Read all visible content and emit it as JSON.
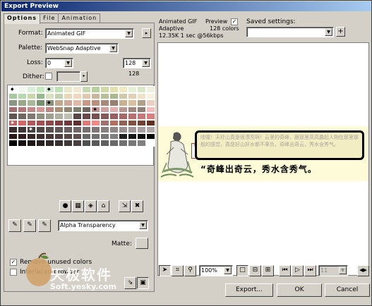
{
  "window": {
    "title": "Export Preview"
  },
  "tabs": [
    {
      "label": "Options"
    },
    {
      "label": "File"
    },
    {
      "label": "Animation"
    }
  ],
  "options": {
    "format_label": "Format:",
    "format_value": "Animated GIF",
    "palette_label": "Palette:",
    "palette_value": "WebSnap Adaptive",
    "loss_label": "Loss:",
    "loss_value": "0",
    "colors_value": "128",
    "colors_count": "128",
    "dither_label": "Dither:",
    "transparency_value": "Alpha Transparency",
    "matte_label": "Matte:",
    "remove_unused_label": "Remove unused colors",
    "interlaced_label": "Interlaced browser"
  },
  "palette_rows": [
    [
      "#ffffff",
      "#f0f8f0",
      "#d8f0d8",
      "#c8e8c0",
      "#d0e8d0",
      "#c0e0b8",
      "#e8e8c8",
      "#f0e8d0",
      "#c8d8b0",
      "#b8d0a0",
      "#d0d8a8",
      "#e0e0b0",
      "#f0e8c0",
      "#e8f0d8",
      "#d8e8c8",
      "#f0f0e0"
    ],
    [
      "#a8c8a0",
      "#b8d8b0",
      "#c8d8a8",
      "#98b890",
      "#d8e0c0",
      "#c0d0b0",
      "#e8d8b8",
      "#f0d8c0",
      "#e0c8b0",
      "#c8b8a0",
      "#b8c098",
      "#a8b890",
      "#d0c8a8",
      "#e0d0b8",
      "#f0e0c8",
      "#f8f0e0"
    ],
    [
      "#889880",
      "#98a888",
      "#a8b898",
      "#789070",
      "#889078",
      "#c0a890",
      "#d0a898",
      "#e0b8a8",
      "#c89888",
      "#b89080",
      "#a88878",
      "#988070",
      "#c8b090",
      "#d8c0a0",
      "#b0a088",
      "#e8d0c0"
    ],
    [
      "#a07070",
      "#b07878",
      "#c08888",
      "#d09898",
      "#b88880",
      "#a89078",
      "#908870",
      "#808070",
      "#706860",
      "#c09090",
      "#d0a0a0",
      "#e0b0b0",
      "#b89890",
      "#a08880",
      "#908078",
      "#f0c0c0"
    ],
    [
      "#605850",
      "#706860",
      "#807870",
      "#909080",
      "#a0a090",
      "#b0b0a0",
      "#c0c0b0",
      "#584848",
      "#684848",
      "#785050",
      "#885858",
      "#986060",
      "#a86868",
      "#b87070",
      "#c87878",
      "#d88080"
    ],
    [
      "#c06060",
      "#d06868",
      "#b05858",
      "#a05050",
      "#904848",
      "#804040",
      "#703838",
      "#603030",
      "#e07878",
      "#f08888",
      "#a07070",
      "#b07060",
      "#906050",
      "#805040",
      "#704030",
      "#603020"
    ],
    [
      "#383030",
      "#403838",
      "#484040",
      "#504848",
      "#585050",
      "#605858",
      "#686060",
      "#706868",
      "#787070",
      "#807878",
      "#888080",
      "#908888",
      "#989090",
      "#a09898",
      "#a8a0a0",
      "#b0a8a8"
    ],
    [
      "#281818",
      "#302020",
      "#382828",
      "#403030",
      "#483838",
      "#504040",
      "#584848",
      "#605050",
      "#686868",
      "#707070",
      "#787878",
      "#808080",
      "#202020",
      "#181818",
      "#101010",
      "#080808"
    ],
    [
      "#000000",
      "#181010",
      "#201818",
      "#282020",
      "#302828",
      "#383030",
      "#403838",
      "#484040",
      "#505050",
      "#585858",
      "#606060",
      "#686868",
      "#707070",
      "#787878",
      "#808080",
      "#ffffff"
    ]
  ],
  "preview": {
    "format": "Animated GIF",
    "palette": "Adaptive",
    "stats": "12.35K  1 sec @56kbps",
    "preview_label": "Preview",
    "colors_text": "128 colors",
    "saved_label": "Saved settings:",
    "caption": "“奇峰出奇云，秀水含秀气。",
    "bubble_text": "哇噻！天柱山真是很漂亮啊！云里的奇峰，跟那里高高矗起人物在那里那般的感觉，真是好山好水都不辜负。奇峰出奇云，秀水含秀气。",
    "stamp": "天柱山"
  },
  "zoom": {
    "value": "100%"
  },
  "frame": {
    "value": "11"
  },
  "buttons": {
    "export": "Export...",
    "ok": "OK",
    "cancel": "Cancel"
  },
  "watermark": {
    "line1": "天极软件",
    "line2": "Soft.yesky.com"
  },
  "colors": {
    "titlebar_start": "#0a246a",
    "titlebar_end": "#a6caf0",
    "face": "#d4d0c8"
  }
}
